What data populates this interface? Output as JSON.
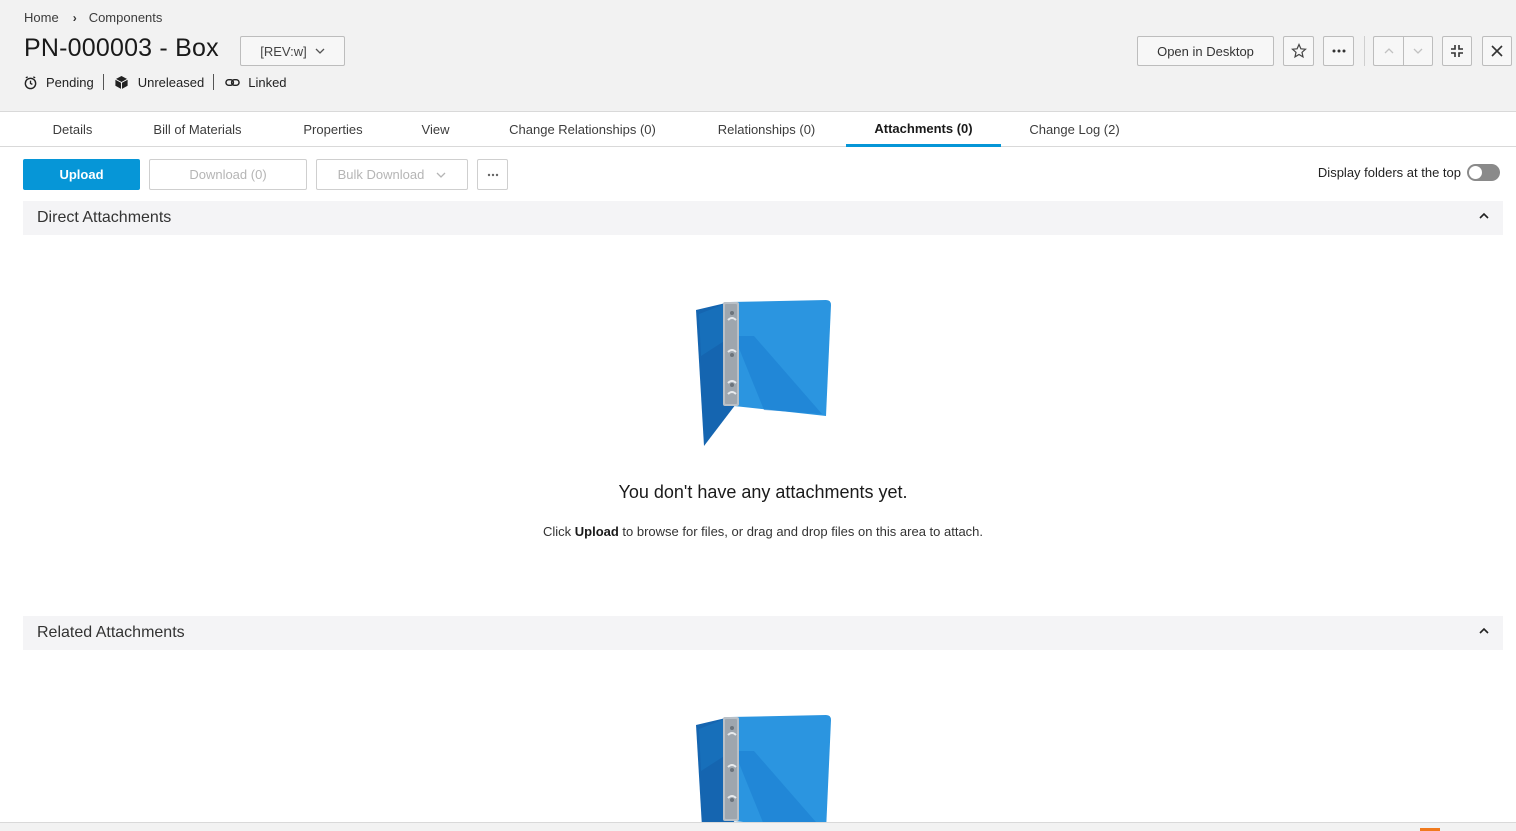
{
  "breadcrumb": {
    "home": "Home",
    "current": "Components"
  },
  "item": {
    "title": "PN-000003 - Box",
    "revision": "[REV:w]"
  },
  "status": [
    {
      "label": "Pending",
      "icon": "clock-icon"
    },
    {
      "label": "Unreleased",
      "icon": "cube-icon"
    },
    {
      "label": "Linked",
      "icon": "link-icon"
    }
  ],
  "header_actions": {
    "open_desktop": "Open in Desktop"
  },
  "tabs": [
    {
      "label": "Details",
      "active": false
    },
    {
      "label": "Bill of Materials",
      "active": false
    },
    {
      "label": "Properties",
      "active": false
    },
    {
      "label": "View",
      "active": false
    },
    {
      "label": "Change Relationships (0)",
      "active": false
    },
    {
      "label": "Relationships (0)",
      "active": false
    },
    {
      "label": "Attachments (0)",
      "active": true
    },
    {
      "label": "Change Log (2)",
      "active": false
    }
  ],
  "toolbar": {
    "upload": "Upload",
    "download": "Download (0)",
    "bulk_download": "Bulk Download",
    "folders_toggle_label": "Display folders at the top",
    "folders_toggle_on": false
  },
  "sections": {
    "direct": "Direct Attachments",
    "related": "Related Attachments"
  },
  "empty_state": {
    "title": "You don't have any attachments yet.",
    "desc_prefix": "Click ",
    "desc_bold": "Upload",
    "desc_suffix": " to browse for files, or drag and drop files on this area to attach."
  },
  "colors": {
    "accent": "#0696d7",
    "binder": "#2b95e0",
    "binder_dark": "#1565b0"
  }
}
